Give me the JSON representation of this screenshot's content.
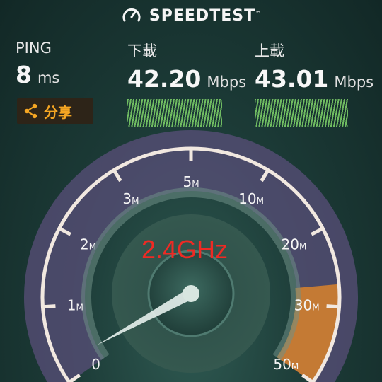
{
  "header": {
    "title": "SPEEDTEST",
    "icon": "speedometer-icon"
  },
  "ping": {
    "label": "PING",
    "value": "8",
    "unit": "ms"
  },
  "download": {
    "label": "下載",
    "value": "42.20",
    "unit": "Mbps"
  },
  "upload": {
    "label": "上載",
    "value": "43.01",
    "unit": "Mbps"
  },
  "share": {
    "label": "分享",
    "icon": "share-icon"
  },
  "gauge": {
    "ticks": [
      {
        "value": "0",
        "unit": ""
      },
      {
        "value": "1",
        "unit": "M"
      },
      {
        "value": "2",
        "unit": "M"
      },
      {
        "value": "3",
        "unit": "M"
      },
      {
        "value": "5",
        "unit": "M"
      },
      {
        "value": "10",
        "unit": "M"
      },
      {
        "value": "20",
        "unit": "M"
      },
      {
        "value": "30",
        "unit": "M"
      },
      {
        "value": "50",
        "unit": "M"
      }
    ],
    "needle_value": "0"
  },
  "annotation": "2.4GHz",
  "colors": {
    "accent": "#f5a623",
    "spark": "#7fd36a",
    "annotation": "#ee2a24",
    "gauge_fill": "#5a4f7a"
  }
}
